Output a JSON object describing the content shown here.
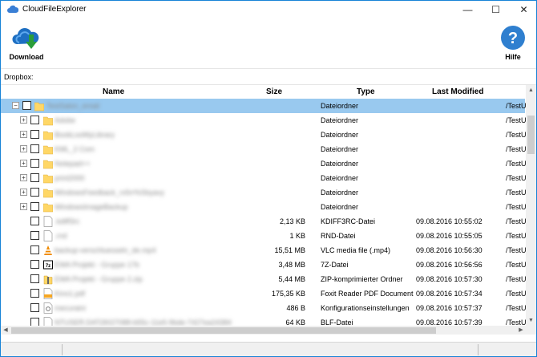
{
  "window": {
    "title": "CloudFileExplorer",
    "minimize": "—",
    "maximize": "☐",
    "close": "✕"
  },
  "toolbar": {
    "download_label": "Download",
    "help_label": "Hilfe"
  },
  "pathbar": {
    "label": "Dropbox:"
  },
  "columns": {
    "name": "Name",
    "size": "Size",
    "type": "Type",
    "modified": "Last Modified"
  },
  "rows": [
    {
      "name": "TestSalon_email",
      "size": "",
      "type": "Dateiordner",
      "modified": "",
      "path": "/TestU",
      "icon": "folder-icon",
      "expander": "−"
    },
    {
      "name": "Adobe",
      "size": "",
      "type": "Dateiordner",
      "modified": "",
      "path": "/TestU",
      "icon": "folder-icon",
      "expander": "+"
    },
    {
      "name": "BookLooMyLibrary",
      "size": "",
      "type": "Dateiordner",
      "modified": "",
      "path": "/TestU",
      "icon": "folder-icon",
      "expander": "+"
    },
    {
      "name": "KML_2 Com",
      "size": "",
      "type": "Dateiordner",
      "modified": "",
      "path": "/TestU",
      "icon": "folder-icon",
      "expander": "+"
    },
    {
      "name": "Notepad++",
      "size": "",
      "type": "Dateiordner",
      "modified": "",
      "path": "/TestU",
      "icon": "folder-icon",
      "expander": "+"
    },
    {
      "name": "print2000",
      "size": "",
      "type": "Dateiordner",
      "modified": "",
      "path": "/TestU",
      "icon": "folder-icon",
      "expander": "+"
    },
    {
      "name": "WindowsFeedback_rx5rr%Sbyavy",
      "size": "",
      "type": "Dateiordner",
      "modified": "",
      "path": "/TestU",
      "icon": "folder-icon",
      "expander": "+"
    },
    {
      "name": "WindowsImageBackup",
      "size": "",
      "type": "Dateiordner",
      "modified": "",
      "path": "/TestU",
      "icon": "folder-icon",
      "expander": "+"
    },
    {
      "name": ".kdiff3rc",
      "size": "2,13 KB",
      "type": "KDIFF3RC-Datei",
      "modified": "09.08.2016 10:55:02",
      "path": "/TestU",
      "icon": "file-icon",
      "expander": ""
    },
    {
      "name": ".rnd",
      "size": "1 KB",
      "type": "RND-Datei",
      "modified": "09.08.2016 10:55:05",
      "path": "/TestU",
      "icon": "file-icon",
      "expander": ""
    },
    {
      "name": "backup-verschluesseln_de.mp4",
      "size": "15,51 MB",
      "type": "VLC media file (.mp4)",
      "modified": "09.08.2016 10:56:30",
      "path": "/TestU",
      "icon": "vlc-icon",
      "expander": ""
    },
    {
      "name": "EWA Projekt - Gruppe 17b",
      "size": "3,48 MB",
      "type": "7Z-Datei",
      "modified": "09.08.2016 10:56:56",
      "path": "/TestU",
      "icon": "7z-icon",
      "expander": ""
    },
    {
      "name": "EWA Projekt - Gruppe 2.zip",
      "size": "5,44 MB",
      "type": "ZIP-komprimierter Ordner",
      "modified": "09.08.2016 10:57:30",
      "path": "/TestU",
      "icon": "zip-icon",
      "expander": ""
    },
    {
      "name": "Kino1.pdf",
      "size": "175,35 KB",
      "type": "Foxit Reader PDF Document",
      "modified": "09.08.2016 10:57:34",
      "path": "/TestU",
      "icon": "pdf-icon",
      "expander": ""
    },
    {
      "name": "mecuraini",
      "size": "486 B",
      "type": "Konfigurationseinstellungen",
      "modified": "09.08.2016 10:57:37",
      "path": "/TestU",
      "icon": "config-icon",
      "expander": ""
    },
    {
      "name": "NTUSER.DAT{9027088-b55c-11e5-9bde-7427ea24384",
      "size": "64 KB",
      "type": "BLF-Datei",
      "modified": "09.08.2016 10:57:39",
      "path": "/TestU",
      "icon": "file-icon",
      "expander": ""
    }
  ],
  "colors": {
    "selection": "#99c9ef",
    "folder": "#ffd766",
    "accent": "#1883d7",
    "help": "#2f7fcf"
  }
}
